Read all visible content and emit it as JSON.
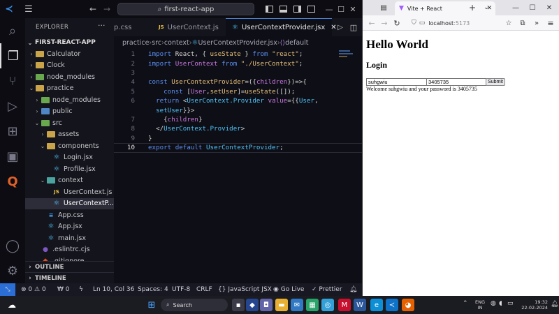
{
  "vscode": {
    "search_text": "first-react-app",
    "explorer_title": "EXPLORER",
    "project_name": "FIRST-REACT-APP",
    "tree": [
      {
        "label": "Calculator",
        "indent": 1,
        "kind": "folder",
        "chev": "›"
      },
      {
        "label": "Clock",
        "indent": 1,
        "kind": "folder",
        "chev": "›"
      },
      {
        "label": "node_modules",
        "indent": 1,
        "kind": "folder-green",
        "chev": "›"
      },
      {
        "label": "practice",
        "indent": 1,
        "kind": "folder-open",
        "chev": "⌄"
      },
      {
        "label": "node_modules",
        "indent": 2,
        "kind": "folder-green",
        "chev": "›"
      },
      {
        "label": "public",
        "indent": 2,
        "kind": "folder-blue",
        "chev": "›"
      },
      {
        "label": "src",
        "indent": 2,
        "kind": "folder-green",
        "chev": "⌄"
      },
      {
        "label": "assets",
        "indent": 3,
        "kind": "folder",
        "chev": "›"
      },
      {
        "label": "components",
        "indent": 3,
        "kind": "folder-open",
        "chev": "⌄"
      },
      {
        "label": "Login.jsx",
        "indent": 4,
        "kind": "react",
        "chev": ""
      },
      {
        "label": "Profile.jsx",
        "indent": 4,
        "kind": "react",
        "chev": ""
      },
      {
        "label": "context",
        "indent": 3,
        "kind": "folder-teal",
        "chev": "⌄"
      },
      {
        "label": "UserContext.js",
        "indent": 4,
        "kind": "js",
        "chev": ""
      },
      {
        "label": "UserContextP...",
        "indent": 4,
        "kind": "react",
        "chev": "",
        "selected": true
      },
      {
        "label": "App.css",
        "indent": 3,
        "kind": "css",
        "chev": ""
      },
      {
        "label": "App.jsx",
        "indent": 3,
        "kind": "react",
        "chev": ""
      },
      {
        "label": "main.jsx",
        "indent": 3,
        "kind": "react",
        "chev": ""
      },
      {
        "label": ".eslintrc.cjs",
        "indent": 2,
        "kind": "eslint",
        "chev": ""
      },
      {
        "label": ".gitignore",
        "indent": 2,
        "kind": "git",
        "chev": ""
      }
    ],
    "outline_label": "OUTLINE",
    "timeline_label": "TIMELINE",
    "tabs": [
      {
        "label": "p.css",
        "icon": "css"
      },
      {
        "label": "UserContext.js",
        "icon": "js"
      },
      {
        "label": "UserContextProvider.jsx",
        "icon": "react",
        "active": true
      }
    ],
    "breadcrumb": [
      "practice",
      "src",
      "context",
      "UserContextProvider.jsx",
      "default"
    ],
    "code_lines": [
      [
        [
          "k",
          "import "
        ],
        [
          "p",
          "React, { "
        ],
        [
          "f",
          "useState"
        ],
        [
          "p",
          " } "
        ],
        [
          "k",
          "from "
        ],
        [
          "s",
          "\"react\""
        ],
        [
          "p",
          ";"
        ]
      ],
      [
        [
          "k",
          "import "
        ],
        [
          "v",
          "UserContext "
        ],
        [
          "k",
          "from "
        ],
        [
          "s",
          "\"./UserContext\""
        ],
        [
          "p",
          ";"
        ]
      ],
      [],
      [
        [
          "k",
          "const "
        ],
        [
          "f",
          "UserContextProvider"
        ],
        [
          "p",
          "=("
        ],
        [
          "p",
          "{"
        ],
        [
          "v",
          "children"
        ],
        [
          "p",
          "})=>{"
        ]
      ],
      [
        [
          "p",
          "    "
        ],
        [
          "k",
          "const "
        ],
        [
          "p",
          "["
        ],
        [
          "v",
          "User"
        ],
        [
          "p",
          ","
        ],
        [
          "f",
          "setUser"
        ],
        [
          "p",
          "]="
        ],
        [
          "f",
          "useState"
        ],
        [
          "p",
          "([]);"
        ]
      ],
      [
        [
          "p",
          "  "
        ],
        [
          "k",
          "return "
        ],
        [
          "p",
          "<"
        ],
        [
          "c",
          "UserContext.Provider "
        ],
        [
          "v",
          "value"
        ],
        [
          "p",
          "={{"
        ],
        [
          "c",
          "User"
        ],
        [
          "p",
          ","
        ]
      ],
      [
        [
          "p",
          "  "
        ],
        [
          "c",
          "setUser"
        ],
        [
          "p",
          "}}>"
        ]
      ],
      [
        [
          "p",
          "    {"
        ],
        [
          "v",
          "children"
        ],
        [
          "p",
          "}"
        ]
      ],
      [
        [
          "p",
          "  </"
        ],
        [
          "c",
          "UserContext.Provider"
        ],
        [
          "p",
          ">"
        ]
      ],
      [
        [
          "p",
          "}"
        ]
      ],
      [
        [
          "k",
          "export "
        ],
        [
          "k",
          "default "
        ],
        [
          "c",
          "UserContextProvider"
        ],
        [
          "p",
          ";"
        ]
      ]
    ],
    "line_numbers": [
      "1",
      "2",
      "3",
      "4",
      "5",
      "6",
      "",
      "7",
      "8",
      "9",
      "10"
    ],
    "current_line": "10",
    "status": {
      "errors": "0",
      "warnings": "0",
      "ports": "0",
      "position": "Ln 10, Col 36",
      "spaces": "Spaces: 4",
      "encoding": "UTF-8",
      "eol": "CRLF",
      "language": "JavaScript JSX",
      "golive": "Go Live",
      "prettier": "Prettier"
    }
  },
  "browser": {
    "tab_title": "Vite + React",
    "url_host": "localhost",
    "url_port": ":5173",
    "heading": "Hello World",
    "subheading": "Login",
    "username_value": "suhgwiu",
    "password_value": "3405735",
    "submit_label": "Submit",
    "message": "Welcome suhgwiu and your password is 3405735"
  },
  "taskbar": {
    "search_label": "Search",
    "lang_top": "ENG",
    "lang_bottom": "IN",
    "time": "19:32",
    "date": "22-02-2024"
  }
}
